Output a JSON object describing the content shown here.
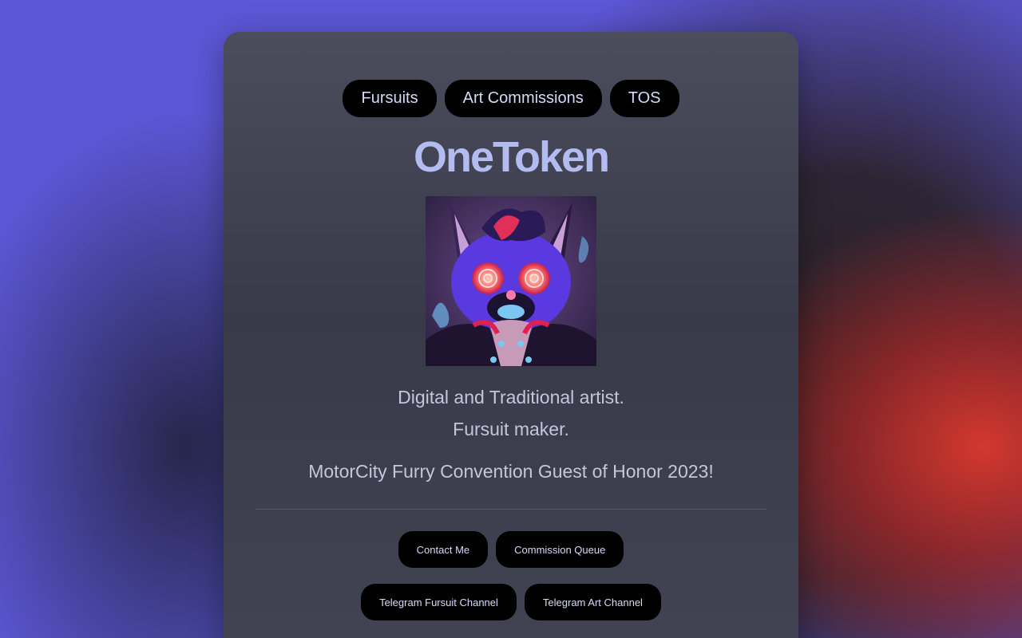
{
  "nav": {
    "items": [
      {
        "label": "Fursuits"
      },
      {
        "label": "Art Commissions"
      },
      {
        "label": "TOS"
      }
    ]
  },
  "profile": {
    "name": "OneToken",
    "bio_line1": "Digital and Traditional artist.",
    "bio_line2": "Fursuit maker.",
    "bio_line3": "MotorCity Furry Convention Guest of Honor 2023!"
  },
  "links": {
    "row1": [
      {
        "label": "Contact Me"
      },
      {
        "label": "Commission Queue"
      }
    ],
    "row2": [
      {
        "label": "Telegram Fursuit Channel"
      },
      {
        "label": "Telegram Art Channel"
      }
    ]
  },
  "colors": {
    "background_blue": "#5b57d6",
    "background_red": "#d6382e",
    "card": "#393a49",
    "title": "#b3bcf0",
    "button_bg": "#000000",
    "button_text": "#d6dafb"
  }
}
